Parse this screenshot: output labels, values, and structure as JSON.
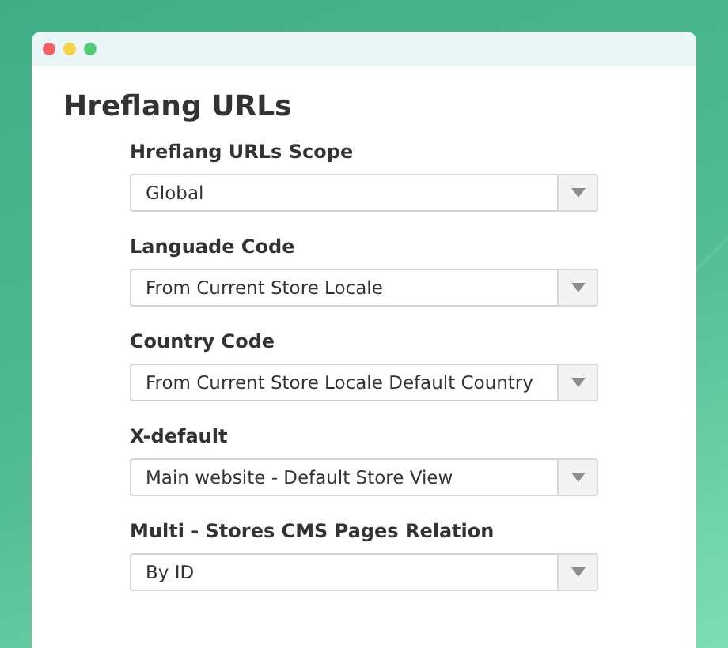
{
  "window": {
    "controls": [
      {
        "color": "#f2606a"
      },
      {
        "color": "#f8d147"
      },
      {
        "color": "#4fcb7a"
      }
    ]
  },
  "section": {
    "title": "Hreflang URLs"
  },
  "fields": [
    {
      "label": "Hreflang URLs Scope",
      "value": "Global"
    },
    {
      "label": "Languade Code",
      "value": "From Current Store Locale"
    },
    {
      "label": "Country Code",
      "value": "From Current Store Locale Default Country"
    },
    {
      "label": "X-default",
      "value": "Main website - Default Store View"
    },
    {
      "label": "Multi - Stores CMS Pages Relation",
      "value": "By ID"
    }
  ]
}
